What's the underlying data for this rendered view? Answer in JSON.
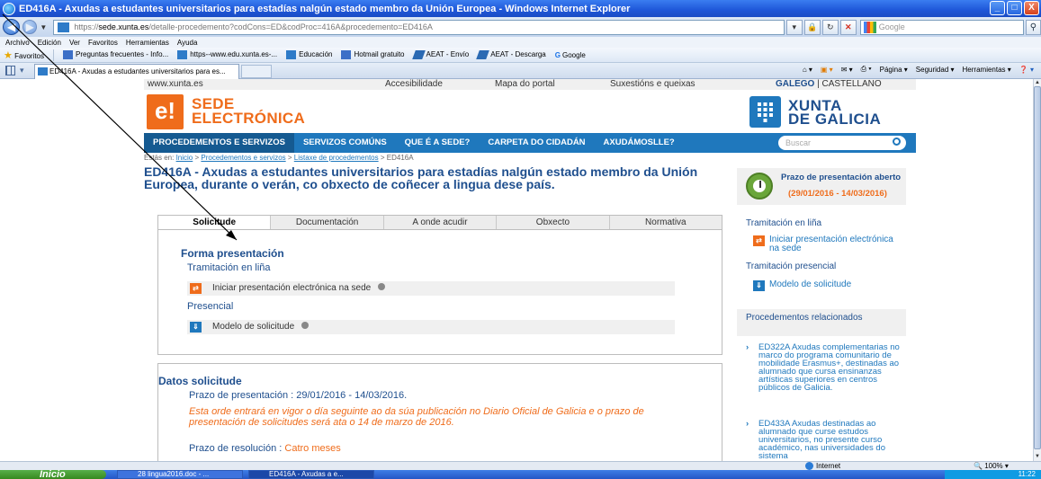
{
  "window": {
    "title": "ED416A - Axudas a estudantes universitarios para estadías nalgún estado membro da Unión Europea - Windows Internet Explorer",
    "min": "_",
    "max": "□",
    "close": "X"
  },
  "address_bar": {
    "url_prefix": "https://",
    "url_host": "sede.xunta.es",
    "url_path": "/detalle-procedemento?codCons=ED&codProc=416A&procedemento=ED416A",
    "search_placeholder": "Google"
  },
  "menu": [
    "Archivo",
    "Edición",
    "Ver",
    "Favoritos",
    "Herramientas",
    "Ayuda"
  ],
  "favorites_bar": {
    "favorites_label": "Favoritos",
    "items": [
      "Preguntas frecuentes - Info...",
      "https--www.edu.xunta.es-...",
      "Educación",
      "Hotmail gratuito",
      "AEAT - Envío",
      "AEAT - Descarga",
      "Google"
    ]
  },
  "browser_tab": {
    "title": "ED416A - Axudas a estudantes universitarios para es..."
  },
  "command_bar": [
    "Página",
    "Seguridad",
    "Herramientas"
  ],
  "site": {
    "top_links": {
      "domain": "www.xunta.es",
      "accesibilidade": "Accesibilidade",
      "mapa": "Mapa do portal",
      "suxestions": "Suxestións e queixas",
      "lang_galego": "GALEGO",
      "lang_sep": " | ",
      "lang_castellano": "CASTELLANO"
    },
    "logo_letter": "e!",
    "sede_line1": "SEDE",
    "sede_line2": "ELECTRÓNICA",
    "xunta_line1": "XUNTA",
    "xunta_line2": "DE GALICIA",
    "nav": [
      "PROCEDEMENTOS E SERVIZOS",
      "SERVIZOS COMÚNS",
      "QUE É A SEDE?",
      "CARPETA DO CIDADÁN",
      "AXUDÁMOSLLE?"
    ],
    "search_placeholder": "Buscar",
    "breadcrumb": {
      "prefix": "Estás en: ",
      "inicio": "Inicio",
      "sep": " > ",
      "procedementos": "Procedementos e servizos",
      "listaxe": "Listaxe de procedementos",
      "current": "ED416A"
    },
    "procedure_title": "ED416A - Axudas a estudantes universitarios para estadías nalgún estado membro da Unión Europea, durante o verán, co obxecto de coñecer a lingua dese país.",
    "tabs": [
      "Solicitude",
      "Documentación",
      "A onde acudir",
      "Obxecto",
      "Normativa"
    ],
    "forma": {
      "title": "Forma presentación",
      "online_label": "Tramitación en liña",
      "online_action": "Iniciar presentación electrónica na sede",
      "presencial_label": "Presencial",
      "presencial_action": "Modelo de solicitude"
    },
    "datos": {
      "title": "Datos solicitude",
      "prazo_label": "Prazo de presentación : ",
      "prazo_value": "29/01/2016 - 14/03/2016.",
      "note": "Esta orde entrará en vigor o día seguinte ao da súa publicación no Diario Oficial de Galicia e o prazo de presentación de solicitudes será ata o 14 de marzo de 2016.",
      "resolucion_label": "Prazo de resolución : ",
      "resolucion_value": "Catro meses"
    },
    "sidebar": {
      "prazo_title": "Prazo de presentación aberto",
      "prazo_dates": "(29/01/2016 - 14/03/2016)",
      "tram_online": "Tramitación en liña",
      "online_link": "Iniciar presentación electrónica na sede",
      "tram_presencial": "Tramitación presencial",
      "presencial_link": "Modelo de solicitude",
      "related_head": "Procedementos relacionados",
      "related": [
        "ED322A Axudas complementarias no marco do programa comunitario de mobilidade Erasmus+, destinadas ao alumnado que cursa ensinanzas artísticas superiores en centros públicos de Galicia.",
        "ED433A Axudas destinadas ao alumnado que curse estudos universitarios, no presente curso académico, nas universidades do sistema"
      ]
    }
  },
  "status_bar": {
    "zone": "Internet",
    "zoom": "100%"
  },
  "taskbar": {
    "start": "Inicio",
    "items": [
      "28 lingua2016.doc - ...",
      "ED416A - Axudas a e..."
    ],
    "clock": "11:22"
  },
  "colors": {
    "brand_orange": "#ef6c1b",
    "brand_blue": "#1f78bd",
    "title_blue": "#1f4f8e"
  }
}
